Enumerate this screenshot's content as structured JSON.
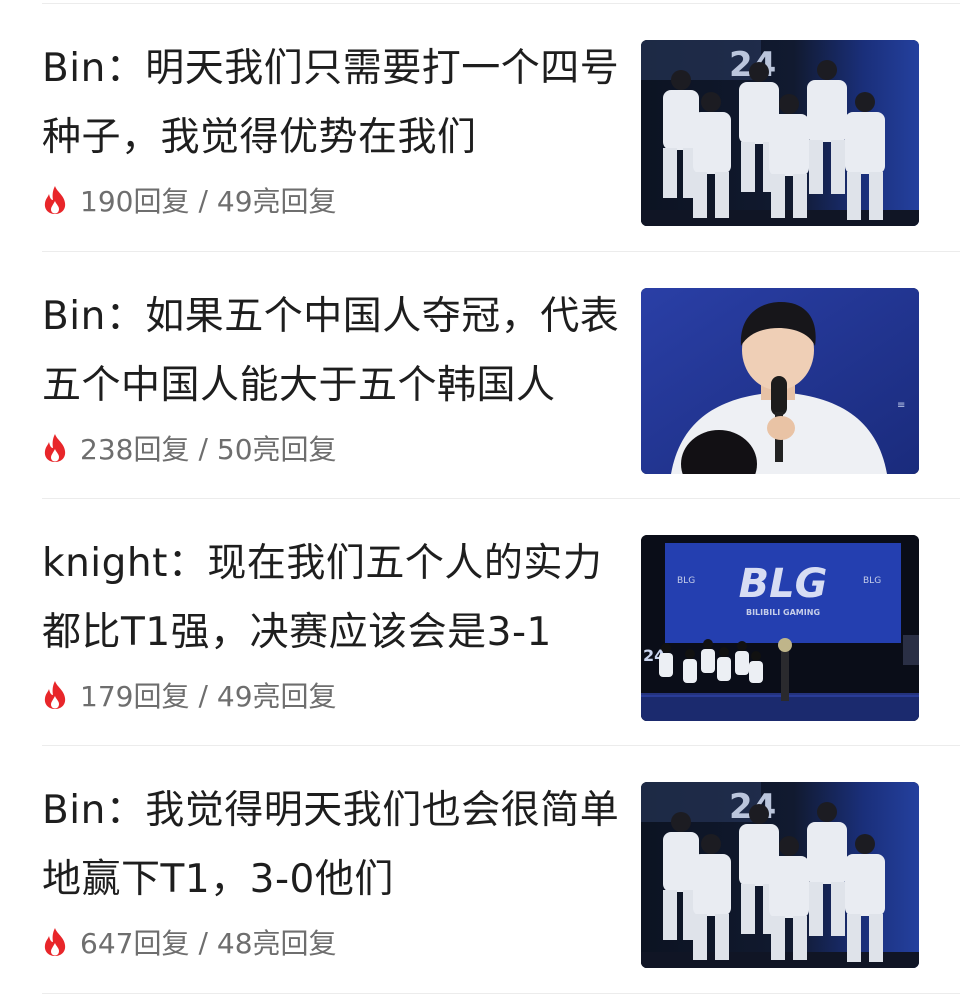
{
  "feed": {
    "items": [
      {
        "title": "Bin：明天我们只需要打一个四号种子，我觉得优势在我们",
        "replies": "190回复",
        "separator": "/",
        "likes": "49亮回复",
        "thumbnail": "team-panel-photo"
      },
      {
        "title": "Bin：如果五个中国人夺冠，代表五个中国人能大于五个韩国人",
        "replies": "238回复",
        "separator": "/",
        "likes": "50亮回复",
        "thumbnail": "player-closeup-photo"
      },
      {
        "title": "knight：现在我们五个人的实力都比T1强，决赛应该会是3-1",
        "replies": "179回复",
        "separator": "/",
        "likes": "49亮回复",
        "thumbnail": "blg-stage-photo",
        "stage_logo": "BLG",
        "stage_subtitle": "BILIBILI GAMING",
        "stage_side": "BLG",
        "stage_year": "24"
      },
      {
        "title": "Bin：我觉得明天我们也会很简单地赢下T1，3-0他们",
        "replies": "647回复",
        "separator": "/",
        "likes": "48亮回复",
        "thumbnail": "team-panel-photo"
      }
    ]
  },
  "colors": {
    "fire": "#e8262a",
    "meta_text": "#6e6e6e",
    "title_text": "#1e1e1e",
    "divider": "#ececec",
    "stage_blue": "#1f3aa8"
  }
}
